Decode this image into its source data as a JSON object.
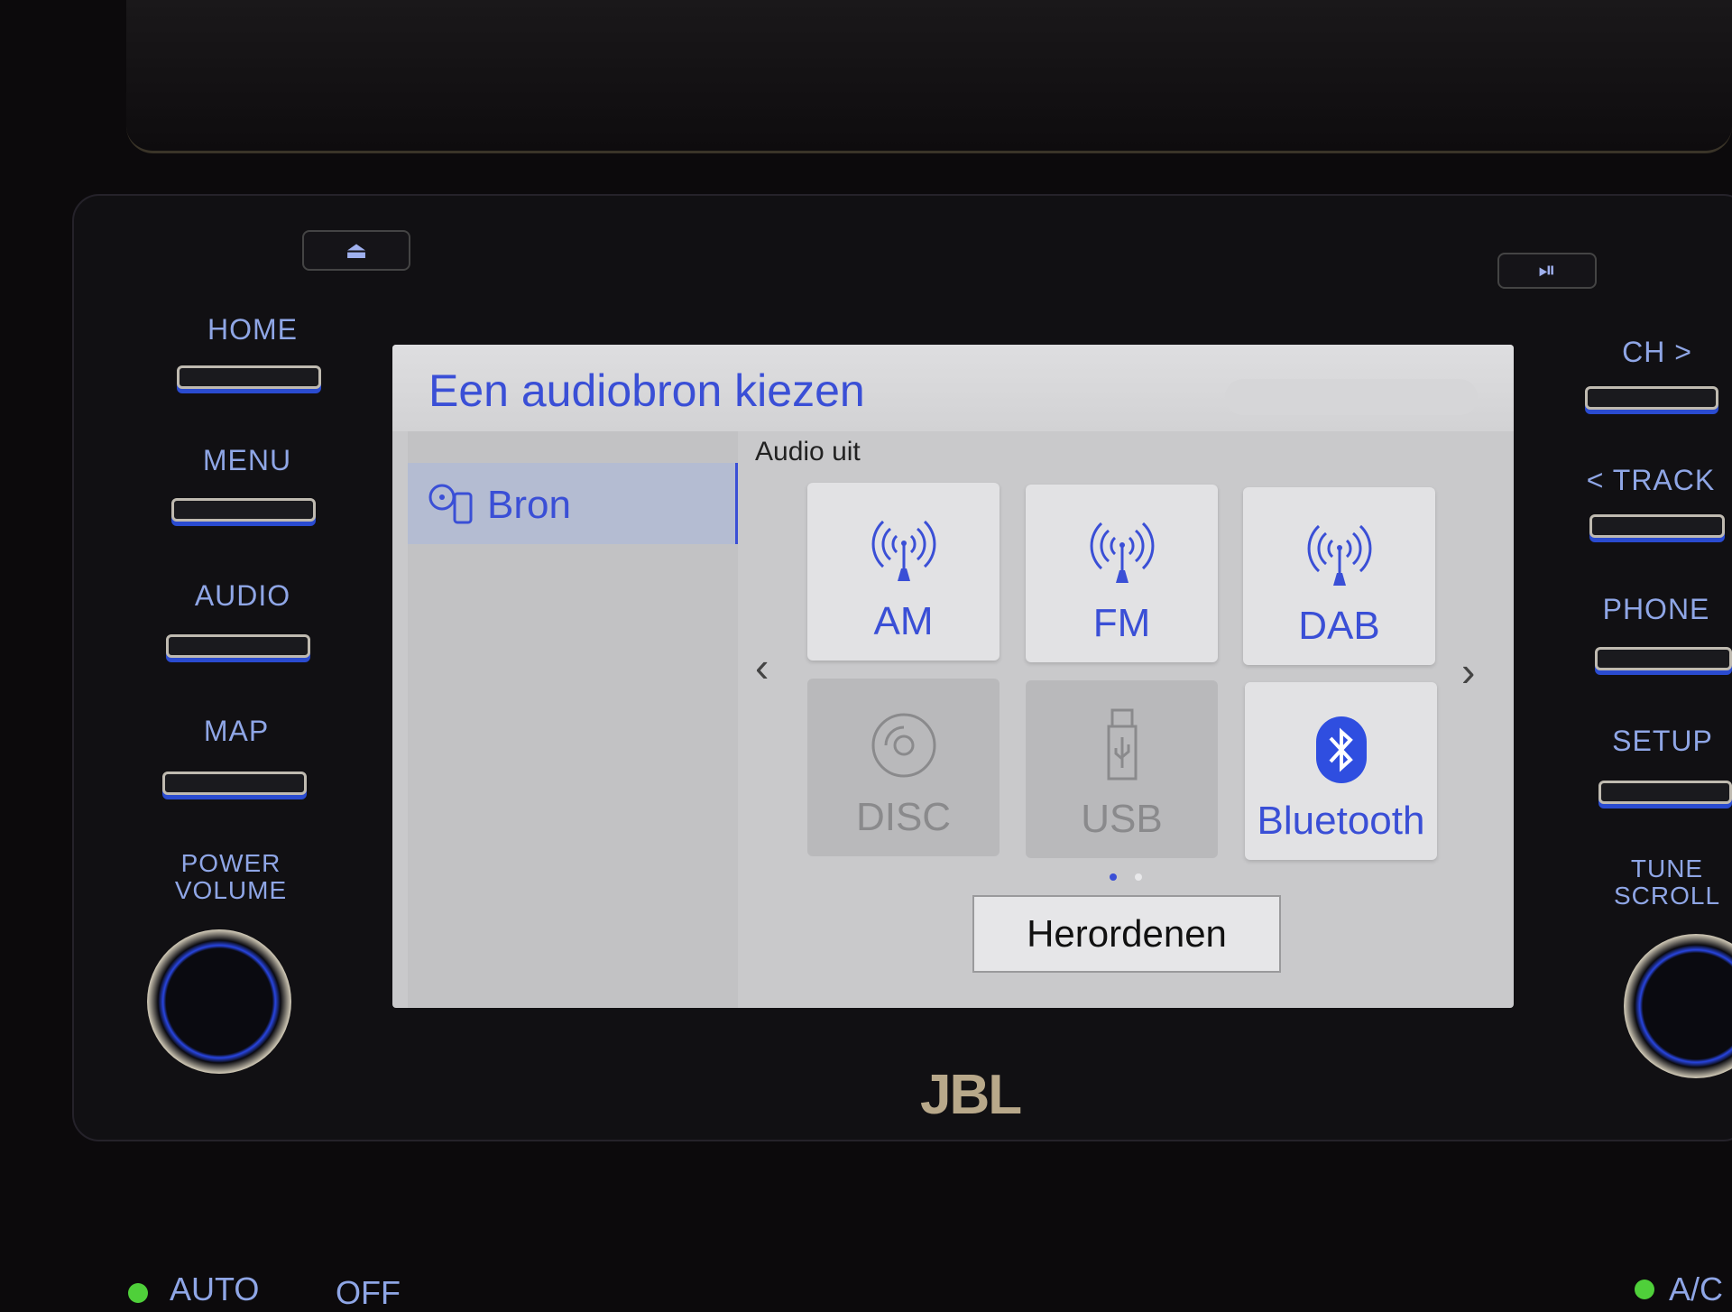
{
  "screen": {
    "title": "Een audiobron kiezen",
    "sidebar": {
      "item": {
        "label": "Bron",
        "icon": "source-icon",
        "selected": true
      }
    },
    "status": "Audio uit",
    "sources": [
      {
        "label": "AM",
        "icon": "antenna-icon",
        "enabled": true
      },
      {
        "label": "FM",
        "icon": "antenna-icon",
        "enabled": true
      },
      {
        "label": "DAB",
        "icon": "antenna-icon",
        "enabled": true
      },
      {
        "label": "DISC",
        "icon": "disc-icon",
        "enabled": false
      },
      {
        "label": "USB",
        "icon": "usb-icon",
        "enabled": false
      },
      {
        "label": "Bluetooth",
        "icon": "bluetooth-icon",
        "enabled": true
      }
    ],
    "page_indicator": {
      "current": 1,
      "total": 2
    },
    "reorder_label": "Herordenen",
    "accent": "#3a4fd6"
  },
  "hardware": {
    "left": [
      "HOME",
      "MENU",
      "AUDIO",
      "MAP"
    ],
    "power_volume": [
      "POWER",
      "VOLUME"
    ],
    "right": [
      "CH >",
      "< TRACK",
      "PHONE",
      "SETUP"
    ],
    "tune_scroll": [
      "TUNE",
      "SCROLL"
    ],
    "brand": "JBL",
    "climate": {
      "auto": "AUTO",
      "off": "OFF",
      "ac": "A/C"
    }
  }
}
